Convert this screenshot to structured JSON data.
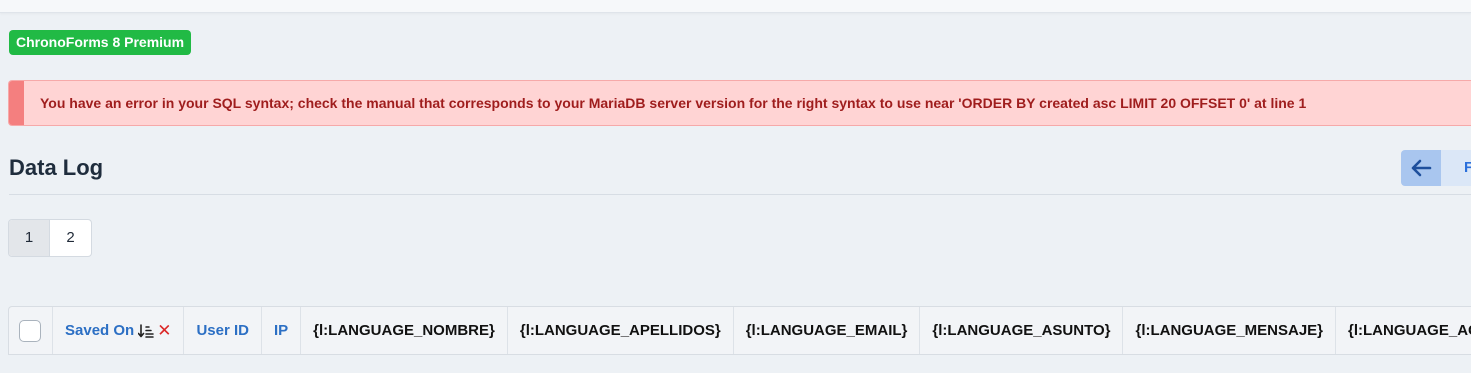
{
  "badge": {
    "label": "ChronoForms 8 Premium"
  },
  "alert": {
    "message": "You have an error in your SQL syntax; check the manual that corresponds to your MariaDB server version for the right syntax to use near 'ORDER BY created asc LIMIT 20 OFFSET 0' at line 1"
  },
  "page": {
    "title": "Data Log"
  },
  "toolbar": {
    "back_icon": "arrow-left-icon",
    "next_label": "F"
  },
  "pagination": {
    "pages": [
      "1",
      "2"
    ],
    "active": "1"
  },
  "table": {
    "columns": [
      {
        "label": "Saved On",
        "sortable": true,
        "sort": "ascending"
      },
      {
        "label": "User ID"
      },
      {
        "label": "IP"
      },
      {
        "label": "{l:LANGUAGE_NOMBRE}"
      },
      {
        "label": "{l:LANGUAGE_APELLIDOS}"
      },
      {
        "label": "{l:LANGUAGE_EMAIL}"
      },
      {
        "label": "{l:LANGUAGE_ASUNTO}"
      },
      {
        "label": "{l:LANGUAGE_MENSAJE}"
      },
      {
        "label": "{l:LANGUAGE_ACEPTA"
      }
    ]
  },
  "colors": {
    "badge": "#21ba45",
    "alert_bg": "#ffd4d4",
    "alert_text": "#9f1d1d",
    "link": "#2c6fc4"
  }
}
